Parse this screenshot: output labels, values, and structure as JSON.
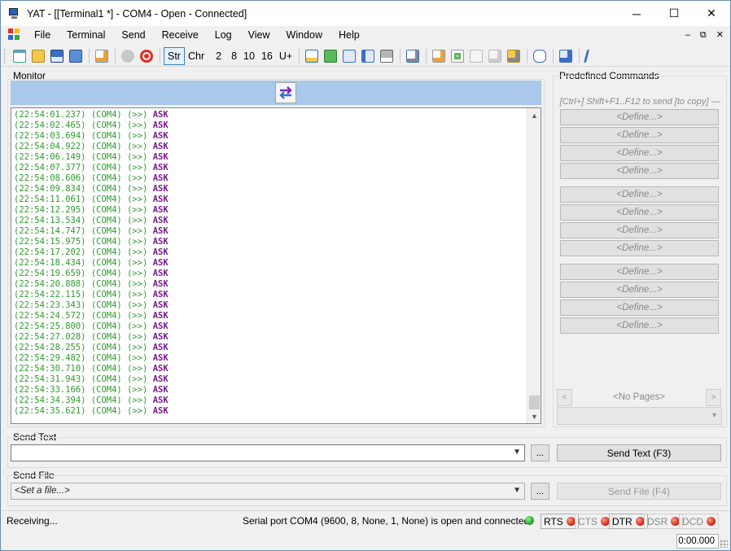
{
  "window": {
    "title": "YAT - [[Terminal1 *] - COM4 - Open - Connected]",
    "controls": [
      "─",
      "☐",
      "✕"
    ]
  },
  "menu": {
    "items": [
      "File",
      "Terminal",
      "Send",
      "Receive",
      "Log",
      "View",
      "Window",
      "Help"
    ],
    "mdi_controls": [
      "–",
      "⧉",
      "✕"
    ]
  },
  "toolbar": {
    "radix_buttons": [
      {
        "label": "Str",
        "active": true
      },
      {
        "label": "Chr",
        "active": false
      },
      {
        "label": "2",
        "active": false
      },
      {
        "label": "8",
        "active": false
      },
      {
        "label": "10",
        "active": false
      },
      {
        "label": "16",
        "active": false
      },
      {
        "label": "U+",
        "active": false
      }
    ]
  },
  "monitor": {
    "label": "Monitor",
    "lines": [
      {
        "time": "(22:54:01.237)",
        "port": "(COM4)",
        "dir": "(>>)",
        "data": "ASK"
      },
      {
        "time": "(22:54:02.465)",
        "port": "(COM4)",
        "dir": "(>>)",
        "data": "ASK"
      },
      {
        "time": "(22:54:03.694)",
        "port": "(COM4)",
        "dir": "(>>)",
        "data": "ASK"
      },
      {
        "time": "(22:54:04.922)",
        "port": "(COM4)",
        "dir": "(>>)",
        "data": "ASK"
      },
      {
        "time": "(22:54:06.149)",
        "port": "(COM4)",
        "dir": "(>>)",
        "data": "ASK"
      },
      {
        "time": "(22:54:07.377)",
        "port": "(COM4)",
        "dir": "(>>)",
        "data": "ASK"
      },
      {
        "time": "(22:54:08.606)",
        "port": "(COM4)",
        "dir": "(>>)",
        "data": "ASK"
      },
      {
        "time": "(22:54:09.834)",
        "port": "(COM4)",
        "dir": "(>>)",
        "data": "ASK"
      },
      {
        "time": "(22:54:11.061)",
        "port": "(COM4)",
        "dir": "(>>)",
        "data": "ASK"
      },
      {
        "time": "(22:54:12.295)",
        "port": "(COM4)",
        "dir": "(>>)",
        "data": "ASK"
      },
      {
        "time": "(22:54:13.534)",
        "port": "(COM4)",
        "dir": "(>>)",
        "data": "ASK"
      },
      {
        "time": "(22:54:14.747)",
        "port": "(COM4)",
        "dir": "(>>)",
        "data": "ASK"
      },
      {
        "time": "(22:54:15.975)",
        "port": "(COM4)",
        "dir": "(>>)",
        "data": "ASK"
      },
      {
        "time": "(22:54:17.202)",
        "port": "(COM4)",
        "dir": "(>>)",
        "data": "ASK"
      },
      {
        "time": "(22:54:18.434)",
        "port": "(COM4)",
        "dir": "(>>)",
        "data": "ASK"
      },
      {
        "time": "(22:54:19.659)",
        "port": "(COM4)",
        "dir": "(>>)",
        "data": "ASK"
      },
      {
        "time": "(22:54:20.888)",
        "port": "(COM4)",
        "dir": "(>>)",
        "data": "ASK"
      },
      {
        "time": "(22:54:22.115)",
        "port": "(COM4)",
        "dir": "(>>)",
        "data": "ASK"
      },
      {
        "time": "(22:54:23.343)",
        "port": "(COM4)",
        "dir": "(>>)",
        "data": "ASK"
      },
      {
        "time": "(22:54:24.572)",
        "port": "(COM4)",
        "dir": "(>>)",
        "data": "ASK"
      },
      {
        "time": "(22:54:25.800)",
        "port": "(COM4)",
        "dir": "(>>)",
        "data": "ASK"
      },
      {
        "time": "(22:54:27.028)",
        "port": "(COM4)",
        "dir": "(>>)",
        "data": "ASK"
      },
      {
        "time": "(22:54:28.255)",
        "port": "(COM4)",
        "dir": "(>>)",
        "data": "ASK"
      },
      {
        "time": "(22:54:29.482)",
        "port": "(COM4)",
        "dir": "(>>)",
        "data": "ASK"
      },
      {
        "time": "(22:54:30.710)",
        "port": "(COM4)",
        "dir": "(>>)",
        "data": "ASK"
      },
      {
        "time": "(22:54:31.943)",
        "port": "(COM4)",
        "dir": "(>>)",
        "data": "ASK"
      },
      {
        "time": "(22:54:33.166)",
        "port": "(COM4)",
        "dir": "(>>)",
        "data": "ASK"
      },
      {
        "time": "(22:54:34.394)",
        "port": "(COM4)",
        "dir": "(>>)",
        "data": "ASK"
      },
      {
        "time": "(22:54:35.621)",
        "port": "(COM4)",
        "dir": "(>>)",
        "data": "ASK"
      }
    ]
  },
  "predefined": {
    "label": "Predefined Commands",
    "hint": "[Ctrl+] Shift+F1..F12 to send [to copy] —",
    "buttons": [
      "<Define...>",
      "<Define...>",
      "<Define...>",
      "<Define...>",
      "<Define...>",
      "<Define...>",
      "<Define...>",
      "<Define...>",
      "<Define...>",
      "<Define...>",
      "<Define...>",
      "<Define...>"
    ],
    "pages_label": "<No Pages>",
    "prev": "<",
    "next": ">"
  },
  "send_text": {
    "label": "Send Text",
    "value": "",
    "dots": "...",
    "button": "Send Text (F3)"
  },
  "send_file": {
    "label": "Send File",
    "placeholder": "<Set a file...>",
    "dots": "...",
    "button": "Send File (F4)"
  },
  "status": {
    "left": "Receiving...",
    "port_info": "Serial port COM4 (9600, 8, None, 1, None) is open and connected",
    "signals": [
      {
        "name": "RTS",
        "state": "red",
        "enabled": true
      },
      {
        "name": "CTS",
        "state": "red",
        "enabled": false
      },
      {
        "name": "DTR",
        "state": "red",
        "enabled": true
      },
      {
        "name": "DSR",
        "state": "red",
        "enabled": false
      },
      {
        "name": "DCD",
        "state": "red",
        "enabled": false
      }
    ],
    "timer": "0:00.000"
  },
  "colors": {
    "log_meta": "#2e9b2e",
    "log_data": "#7a1a8f",
    "monitor_bar": "#a9c8ea"
  }
}
